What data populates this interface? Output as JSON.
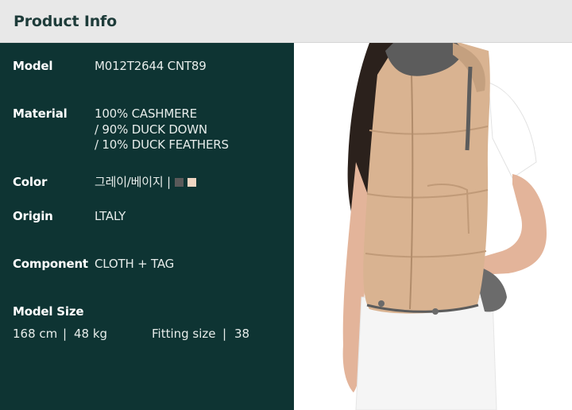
{
  "header": {
    "title": "Product Info"
  },
  "specs": {
    "model": {
      "label": "Model",
      "value": "M012T2644 CNT89"
    },
    "material": {
      "label": "Material",
      "lines": [
        "100% CASHMERE",
        "/ 90% DUCK DOWN",
        "/ 10% DUCK FEATHERS"
      ]
    },
    "color": {
      "label": "Color",
      "value": "그레이/베이지 |",
      "swatches": [
        "#5a5a5a",
        "#efd6c2"
      ]
    },
    "origin": {
      "label": "Origin",
      "value": "LTALY"
    },
    "component": {
      "label": "Component",
      "value": "CLOTH + TAG"
    },
    "model_size": {
      "label": "Model Size",
      "height": "168 cm",
      "sep": "|",
      "weight": "48 kg",
      "fitting_label": "Fitting size",
      "fitting_value": "38"
    }
  },
  "colors": {
    "panel": "#0e3433",
    "header": "#e8e8e8",
    "title": "#1e3c3a"
  }
}
